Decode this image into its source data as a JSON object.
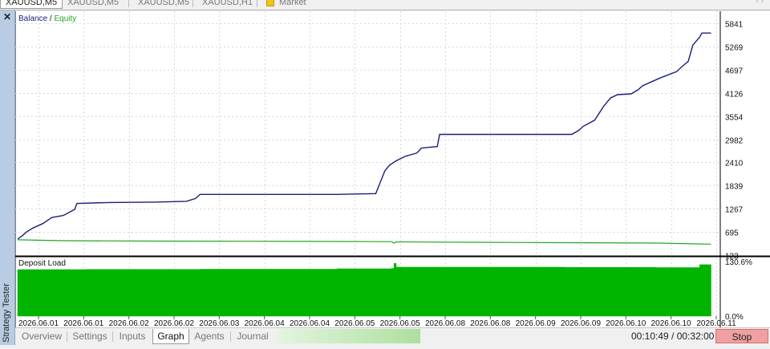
{
  "tabs": [
    {
      "label": "XAUUSD,M5",
      "active": true
    },
    {
      "label": "XAUUSD,M5",
      "active": false
    },
    {
      "label": "XAUUSD,M5",
      "active": false
    },
    {
      "label": "XAUUSD,H1",
      "active": false
    },
    {
      "label": "Market",
      "active": false,
      "icon": "market-icon"
    }
  ],
  "side_panel": {
    "close_label": "✕",
    "title": "Strategy Tester"
  },
  "colors": {
    "balance": "#1c1f7a",
    "equity": "#22a622",
    "load_fill": "#00b400",
    "separator": "#000000"
  },
  "chart_data": {
    "type": "line",
    "legend": {
      "balance": "Balance",
      "separator": "/",
      "equity": "Equity"
    },
    "x_ticks": [
      "2026.06.01",
      "2026.06.01",
      "2026.06.02",
      "2026.06.02",
      "2026.06.03",
      "2026.06.04",
      "2026.06.04",
      "2026.06.05",
      "2026.06.05",
      "2026.06.08",
      "2026.06.08",
      "2026.06.09",
      "2026.06.09",
      "2026.06.10",
      "2026.06.10",
      "2026.06.11"
    ],
    "y_ticks": [
      "5841",
      "5269",
      "4697",
      "4126",
      "3554",
      "2982",
      "2410",
      "1839",
      "1267",
      "695",
      "123"
    ],
    "ylim": [
      123,
      5841
    ],
    "x_range": [
      0,
      15.35
    ],
    "series": [
      {
        "name": "Balance",
        "key": "balance",
        "points": [
          [
            0,
            520
          ],
          [
            0.1,
            600
          ],
          [
            0.2,
            700
          ],
          [
            0.35,
            800
          ],
          [
            0.55,
            900
          ],
          [
            0.75,
            1050
          ],
          [
            1.0,
            1100
          ],
          [
            1.25,
            1250
          ],
          [
            1.3,
            1400
          ],
          [
            2.0,
            1420
          ],
          [
            3.0,
            1430
          ],
          [
            3.7,
            1450
          ],
          [
            3.9,
            1520
          ],
          [
            4.0,
            1620
          ],
          [
            5.0,
            1620
          ],
          [
            6.0,
            1620
          ],
          [
            7.0,
            1620
          ],
          [
            7.85,
            1640
          ],
          [
            7.95,
            1920
          ],
          [
            8.05,
            2200
          ],
          [
            8.15,
            2340
          ],
          [
            8.3,
            2450
          ],
          [
            8.5,
            2560
          ],
          [
            8.75,
            2640
          ],
          [
            8.85,
            2760
          ],
          [
            9.0,
            2780
          ],
          [
            9.2,
            2800
          ],
          [
            9.25,
            3100
          ],
          [
            10.0,
            3100
          ],
          [
            11.0,
            3100
          ],
          [
            12.15,
            3100
          ],
          [
            12.3,
            3200
          ],
          [
            12.4,
            3300
          ],
          [
            12.65,
            3450
          ],
          [
            12.85,
            3800
          ],
          [
            13.0,
            4000
          ],
          [
            13.15,
            4080
          ],
          [
            13.45,
            4100
          ],
          [
            13.6,
            4200
          ],
          [
            13.7,
            4300
          ],
          [
            13.9,
            4400
          ],
          [
            14.1,
            4500
          ],
          [
            14.45,
            4650
          ],
          [
            14.55,
            4760
          ],
          [
            14.7,
            4900
          ],
          [
            14.75,
            5100
          ],
          [
            14.8,
            5300
          ],
          [
            14.95,
            5500
          ],
          [
            15.0,
            5600
          ],
          [
            15.2,
            5600
          ]
        ]
      },
      {
        "name": "Equity",
        "key": "equity",
        "points": [
          [
            0,
            500
          ],
          [
            1,
            480
          ],
          [
            3,
            470
          ],
          [
            5,
            465
          ],
          [
            8.2,
            455
          ],
          [
            8.25,
            420
          ],
          [
            8.3,
            450
          ],
          [
            10,
            440
          ],
          [
            12,
            430
          ],
          [
            14,
            420
          ],
          [
            14.9,
            400
          ],
          [
            15.2,
            395
          ]
        ]
      }
    ],
    "subchart": {
      "title": "Deposit Load",
      "y_ticks": [
        "130.6%",
        "0.0%"
      ],
      "ylim": [
        0,
        130.6
      ],
      "steps": [
        [
          0,
          113
        ],
        [
          1.5,
          113.5
        ],
        [
          4,
          114
        ],
        [
          7,
          115
        ],
        [
          8.2,
          116
        ],
        [
          8.25,
          128
        ],
        [
          8.3,
          119
        ],
        [
          11,
          119
        ],
        [
          12,
          118.5
        ],
        [
          14,
          118
        ],
        [
          14.9,
          118
        ],
        [
          14.95,
          125
        ],
        [
          15.2,
          125
        ]
      ]
    }
  },
  "bottom_tabs": [
    {
      "label": "Overview",
      "active": false
    },
    {
      "label": "Settings",
      "active": false
    },
    {
      "label": "Inputs",
      "active": false
    },
    {
      "label": "Graph",
      "active": true
    },
    {
      "label": "Agents",
      "active": false
    },
    {
      "label": "Journal",
      "active": false
    }
  ],
  "progress": 0.34,
  "timer": "00:10:49 / 00:32:00",
  "stop_label": "Stop"
}
